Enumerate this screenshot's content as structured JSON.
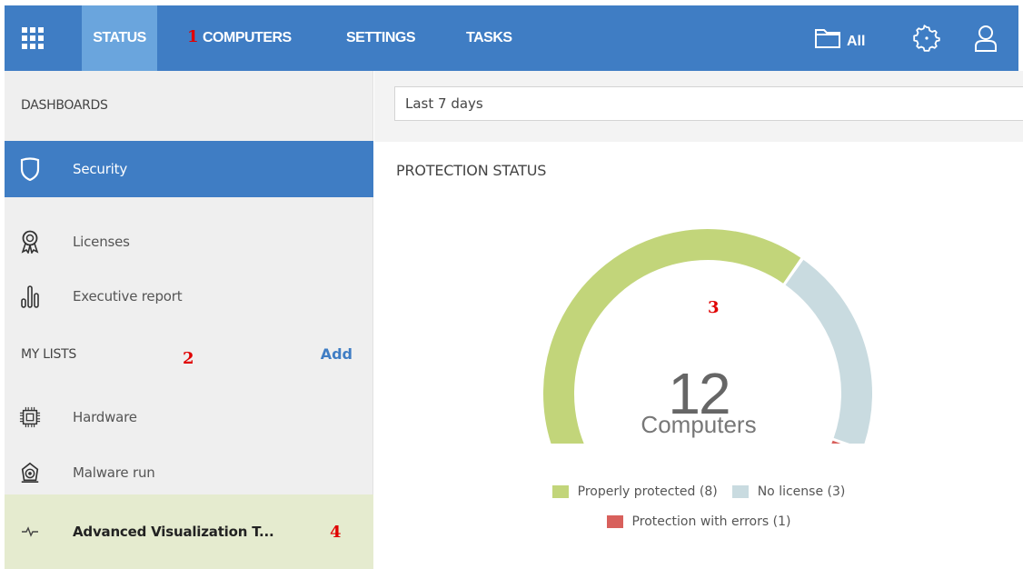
{
  "topbar": {
    "tabs": [
      {
        "label": "STATUS",
        "active": true
      },
      {
        "label": "COMPUTERS",
        "active": false
      },
      {
        "label": "SETTINGS",
        "active": false
      },
      {
        "label": "TASKS",
        "active": false
      }
    ],
    "folder_label": "All",
    "icons": [
      "apps-grid-icon",
      "folder-icon",
      "gear-icon",
      "user-icon"
    ],
    "accent_color": "#3f7dc4",
    "active_tab_color": "#6aa5dd"
  },
  "annotations": {
    "marker_1": "1",
    "marker_2": "2",
    "marker_3": "3",
    "marker_4": "4",
    "marker_color": "#e00000"
  },
  "sidebar": {
    "dashboards_header": "DASHBOARDS",
    "dashboards": [
      {
        "label": "Security",
        "icon": "shield-icon",
        "active": true
      },
      {
        "label": "Licenses",
        "icon": "award-icon",
        "active": false
      },
      {
        "label": "Executive report",
        "icon": "bar-report-icon",
        "active": false
      }
    ],
    "lists_header": "MY LISTS",
    "add_label": "Add",
    "lists": [
      {
        "label": "Hardware",
        "icon": "chip-icon"
      },
      {
        "label": "Malware run",
        "icon": "malware-icon"
      },
      {
        "label": "Advanced Visualization T...",
        "icon": "pulse-icon",
        "highlighted": true
      }
    ]
  },
  "main": {
    "date_filter": "Last 7 days",
    "section_title": "PROTECTION STATUS",
    "total_value": "12",
    "total_unit": "Computers"
  },
  "chart_data": {
    "type": "pie",
    "style": "semi-donut gauge",
    "title": "PROTECTION STATUS",
    "total": 12,
    "series": [
      {
        "name": "Properly protected",
        "value": 8,
        "legend": "Properly protected (8)",
        "color": "#c2d57a"
      },
      {
        "name": "No license",
        "value": 3,
        "legend": "No license (3)",
        "color": "#c9dbe0"
      },
      {
        "name": "Protection with errors",
        "value": 1,
        "legend": "Protection with errors (1)",
        "color": "#d8605c"
      }
    ]
  }
}
